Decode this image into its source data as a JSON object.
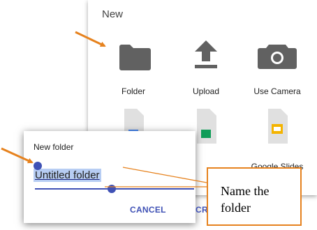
{
  "new_sheet": {
    "title": "New",
    "items": [
      {
        "label": "Folder",
        "icon": "folder-icon"
      },
      {
        "label": "Upload",
        "icon": "upload-icon"
      },
      {
        "label": "Use Camera",
        "icon": "camera-icon"
      },
      {
        "label": "",
        "icon": "google-docs-icon"
      },
      {
        "label": "",
        "icon": "google-sheets-icon"
      },
      {
        "label": "Google Slides",
        "icon": "google-slides-icon"
      }
    ]
  },
  "dialog": {
    "title": "New folder",
    "input_value": "Untitled folder",
    "cancel_label": "CANCEL",
    "create_label": "CR"
  },
  "callout": {
    "text": "Name the folder"
  },
  "colors": {
    "accent": "#3f51b5",
    "annotation_orange": "#e6821e",
    "icon_gray": "#616161",
    "selection": "#b7cdf3"
  }
}
